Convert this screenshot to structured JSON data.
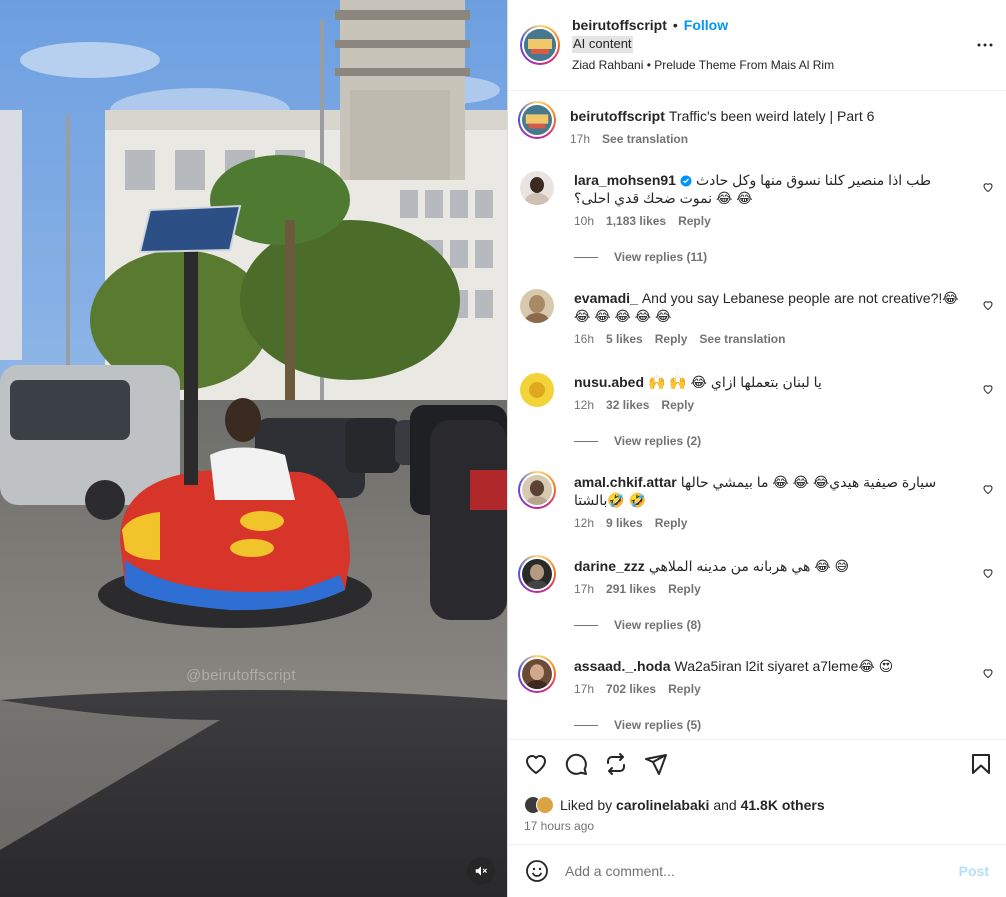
{
  "media": {
    "watermark": "@beirutoffscript",
    "mute_icon": "speaker-muted-icon"
  },
  "post_header": {
    "username": "beirutoffscript",
    "separator": "•",
    "follow_label": "Follow",
    "ai_label": "AI content",
    "audio": "Ziad Rahbani • Prelude Theme From Mais Al Rim",
    "more_icon": "more-options-icon"
  },
  "caption": {
    "username": "beirutoffscript",
    "text": "Traffic's been weird lately | Part 6",
    "time": "17h",
    "see_translation": "See translation"
  },
  "comments": [
    {
      "username": "lara_mohsen91",
      "verified": true,
      "text": "طب اذا منصير كلنا نسوق منها وكل حادث نموت ضحك قدي احلى؟ 😂 😂",
      "time": "10h",
      "likes": "1,183 likes",
      "reply": "Reply",
      "view_replies": "View replies (11)"
    },
    {
      "username": "evamadi_",
      "text": "And you say Lebanese people are not creative?!😂 😂 😂 😂 😂 😂",
      "time": "16h",
      "likes": "5 likes",
      "reply": "Reply",
      "see_translation": "See translation"
    },
    {
      "username": "nusu.abed",
      "text": "🙌 🙌 😂 يا لبنان بتعملها ازاي",
      "time": "12h",
      "likes": "32 likes",
      "reply": "Reply",
      "view_replies": "View replies (2)"
    },
    {
      "username": "amal.chkif.attar",
      "text": "سيارة صيفية هيدي😂 😂 😂 ما بيمشي حالها بالشتا🤣 🤣",
      "time": "12h",
      "likes": "9 likes",
      "reply": "Reply"
    },
    {
      "username": "darine_zzz",
      "text": "هي هربانه من مدينه الملاهي 😂 😅",
      "time": "17h",
      "likes": "291 likes",
      "reply": "Reply",
      "view_replies": "View replies (8)"
    },
    {
      "username": "assaad._.hoda",
      "text": "Wa2a5iran l2it siyaret a7leme😂 😍",
      "time": "17h",
      "likes": "702 likes",
      "reply": "Reply",
      "view_replies": "View replies (5)"
    }
  ],
  "actions": {
    "like_icon": "heart-icon",
    "comment_icon": "comment-icon",
    "repost_icon": "repost-icon",
    "share_icon": "share-icon",
    "save_icon": "bookmark-icon",
    "liked_by_prefix": "Liked by",
    "liked_by_user": "carolinelabaki",
    "liked_by_and": "and",
    "liked_by_others": "41.8K others",
    "time_ago": "17 hours ago"
  },
  "add_comment": {
    "emoji_icon": "emoji-icon",
    "placeholder": "Add a comment...",
    "post_label": "Post"
  },
  "colors": {
    "accent": "#0095f6",
    "muted": "#737373",
    "text": "#262626",
    "post_disabled": "#b2dffc"
  }
}
